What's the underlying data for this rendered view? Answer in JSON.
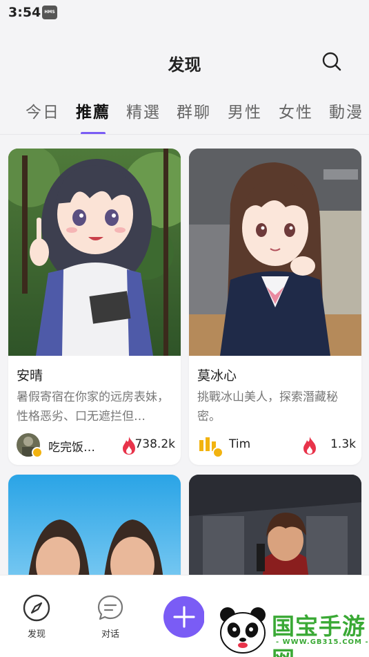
{
  "status_bar": {
    "time": "3:54",
    "hms_badge": "HMS"
  },
  "header": {
    "title": "发现",
    "search_icon": "search-icon"
  },
  "tabs": [
    {
      "label": "今日",
      "active": false
    },
    {
      "label": "推薦",
      "active": true
    },
    {
      "label": "精選",
      "active": false
    },
    {
      "label": "群聊",
      "active": false
    },
    {
      "label": "男性",
      "active": false
    },
    {
      "label": "女性",
      "active": false
    },
    {
      "label": "動漫",
      "active": false
    }
  ],
  "accent_color": "#7a5cf5",
  "fire_color": "#e8334a",
  "cards": [
    {
      "name": "安晴",
      "description": "暑假寄宿在你家的远房表妹，性格恶劣、口无遮拦但…",
      "author": "吃完饭…",
      "count": "738.2k"
    },
    {
      "name": "莫冰心",
      "description": "挑戰冰山美人，探索潛藏秘密。",
      "author": "Tim",
      "count": "1.3k"
    },
    {
      "name": "",
      "description": "",
      "author": "",
      "count": ""
    },
    {
      "name": "",
      "description": "",
      "author": "",
      "count": ""
    }
  ],
  "bottom_nav": {
    "discover_label": "发现",
    "chat_label": "对话",
    "create_icon": "plus-icon"
  },
  "watermark": {
    "text": "国宝手游网",
    "url": "- WWW.GB315.COM -"
  }
}
